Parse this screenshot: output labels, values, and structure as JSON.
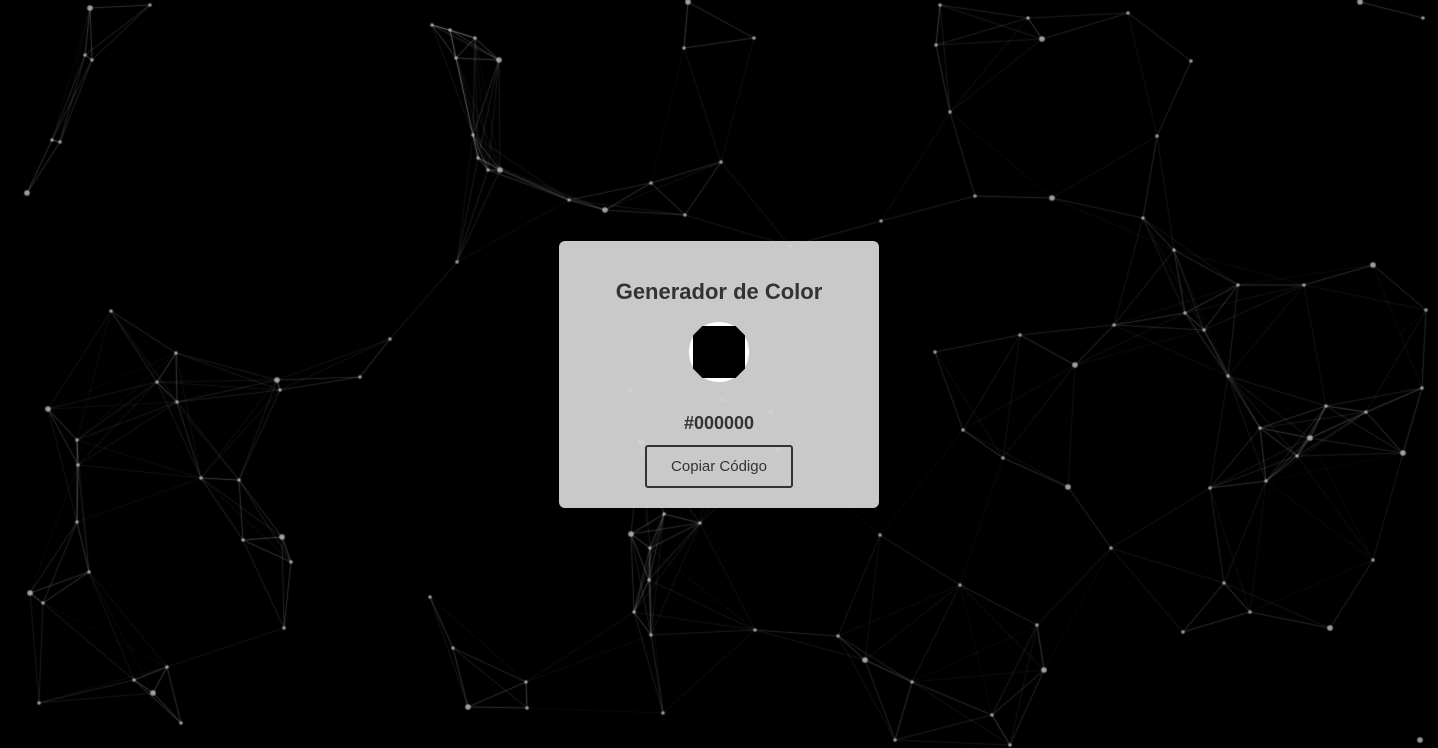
{
  "background": {
    "color": "#000000",
    "line_color": "#ffffff",
    "node_color": "#cccccc"
  },
  "card": {
    "title": "Generador de Color",
    "current_color": "#000000",
    "hex_label": "#000000",
    "copy_button_label": "Copiar Código"
  }
}
